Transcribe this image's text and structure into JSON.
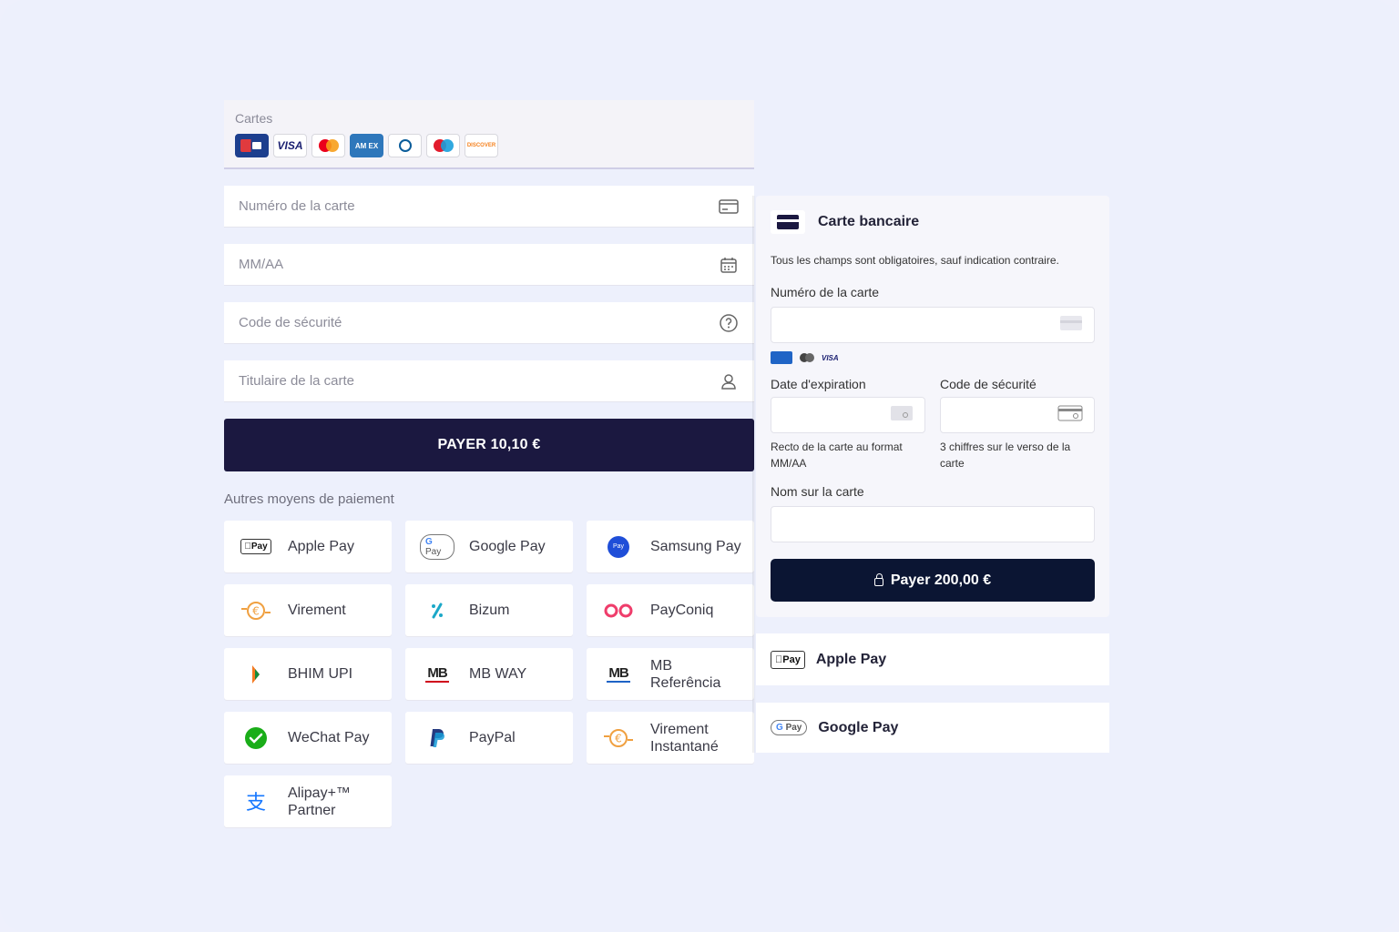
{
  "left": {
    "cards_label": "Cartes",
    "card_logos": [
      "cb-logo",
      "visa-logo",
      "mastercard-logo",
      "amex-logo",
      "diners-logo",
      "maestro-logo",
      "discover-logo"
    ],
    "logo_text": {
      "visa": "VISA",
      "amex": "AM EX",
      "discover_a": "DISC",
      "discover_b": "OVER"
    },
    "fields": {
      "card_number": "Numéro de la carte",
      "expiry": "MM/AA",
      "cvc": "Code de sécurité",
      "holder": "Titulaire de la carte"
    },
    "pay_button": "PAYER 10,10 €",
    "other_title": "Autres moyens de paiement",
    "methods": [
      {
        "label": "Apple Pay",
        "icon": "apple-pay-icon"
      },
      {
        "label": "Google Pay",
        "icon": "google-pay-icon"
      },
      {
        "label": "Samsung Pay",
        "icon": "samsung-pay-icon"
      },
      {
        "label": "Virement",
        "icon": "euro-transfer-icon"
      },
      {
        "label": "Bizum",
        "icon": "bizum-icon"
      },
      {
        "label": "PayConiq",
        "icon": "payconiq-icon"
      },
      {
        "label": "BHIM UPI",
        "icon": "bhim-upi-icon"
      },
      {
        "label": "MB WAY",
        "icon": "mb-way-icon"
      },
      {
        "label": "MB Referência",
        "icon": "mb-referencia-icon"
      },
      {
        "label": "WeChat Pay",
        "icon": "wechat-pay-icon"
      },
      {
        "label": "PayPal",
        "icon": "paypal-icon"
      },
      {
        "label": "Virement Instantané",
        "icon": "euro-instant-transfer-icon"
      },
      {
        "label": "Alipay+™ Partner",
        "icon": "alipay-icon"
      }
    ],
    "badge_text": {
      "pay": "Pay",
      "gpay_g": "G",
      "gpay_pay": "Pay",
      "mb": "MB"
    }
  },
  "right": {
    "title": "Carte bancaire",
    "note": "Tous les champs sont obligatoires, sauf indication contraire.",
    "card_number_label": "Numéro de la carte",
    "mini_logos": {
      "visa": "VISA"
    },
    "expiry_label": "Date d'expiration",
    "expiry_hint": "Recto de la carte au format MM/AA",
    "cvc_label": "Code de sécurité",
    "cvc_hint": "3 chiffres sur le verso de la carte",
    "name_label": "Nom sur la carte",
    "pay_button": "Payer 200,00 €",
    "wallets": [
      {
        "label": "Apple Pay",
        "badge": "Pay"
      },
      {
        "label": "Google Pay",
        "badge_g": "G",
        "badge": "Pay"
      }
    ]
  },
  "colors": {
    "background": "#edf0fc",
    "primary_dark": "#1b1840",
    "right_pay": "#0b1533"
  }
}
